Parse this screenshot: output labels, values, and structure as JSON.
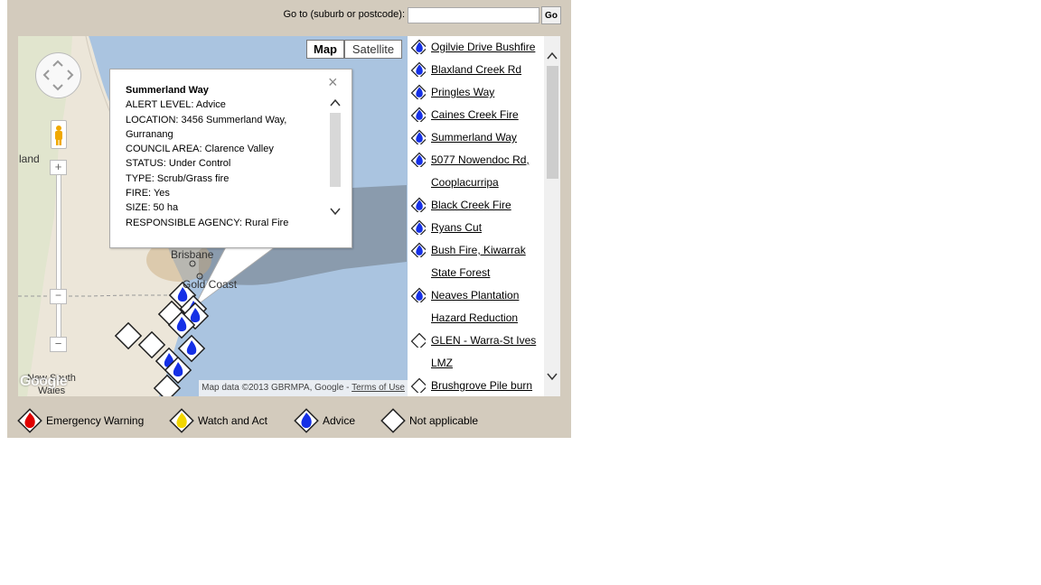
{
  "goto": {
    "label": "Go to (suburb or postcode):",
    "value": "",
    "placeholder": "",
    "button": "Go"
  },
  "map": {
    "type_buttons": {
      "map": "Map",
      "satellite": "Satellite"
    },
    "selected_type": "Map",
    "labels": {
      "brisbane": "Brisbane",
      "gold_coast": "Gold Coast",
      "island": "land",
      "nsw_line1": "New South",
      "nsw_line2": "Wales"
    },
    "logo": "Google",
    "attribution": "Map data ©2013 GBRMPA, Google -",
    "terms": "Terms of Use"
  },
  "popup": {
    "title": "Summerland Way",
    "lines": [
      "ALERT LEVEL: Advice",
      "LOCATION: 3456 Summerland Way, Gurranang",
      "COUNCIL AREA: Clarence Valley",
      "STATUS: Under Control",
      "TYPE: Scrub/Grass fire",
      "FIRE: Yes",
      "SIZE: 50 ha",
      "RESPONSIBLE AGENCY: Rural Fire"
    ],
    "close": "×"
  },
  "incidents": [
    {
      "name": "Ogilvie Drive Bushfire",
      "level": "Advice"
    },
    {
      "name": "Blaxland Creek Rd",
      "level": "Advice"
    },
    {
      "name": "Pringles Way",
      "level": "Advice"
    },
    {
      "name": "Caines Creek Fire",
      "level": "Advice"
    },
    {
      "name": "Summerland Way",
      "level": "Advice"
    },
    {
      "name": "5077 Nowendoc Rd, Cooplacurripa",
      "level": "Advice"
    },
    {
      "name": "Black Creek Fire",
      "level": "Advice"
    },
    {
      "name": "Ryans Cut",
      "level": "Advice"
    },
    {
      "name": "Bush Fire, Kiwarrak State Forest",
      "level": "Advice"
    },
    {
      "name": "Neaves Plantation Hazard Reduction",
      "level": "Advice"
    },
    {
      "name": "GLEN - Warra-St Ives LMZ",
      "level": "Not applicable"
    },
    {
      "name": "Brushgrove Pile burn",
      "level": "Not applicable"
    }
  ],
  "legend": [
    {
      "label": "Emergency Warning",
      "color": "#e00000"
    },
    {
      "label": "Watch and Act",
      "color": "#f2d600"
    },
    {
      "label": "Advice",
      "color": "#1530e6"
    },
    {
      "label": "Not applicable",
      "color": "#ffffff"
    }
  ],
  "colors": {
    "water": "#aac4e0",
    "land": "#ece6d9",
    "frame": "#d3cbbd"
  }
}
